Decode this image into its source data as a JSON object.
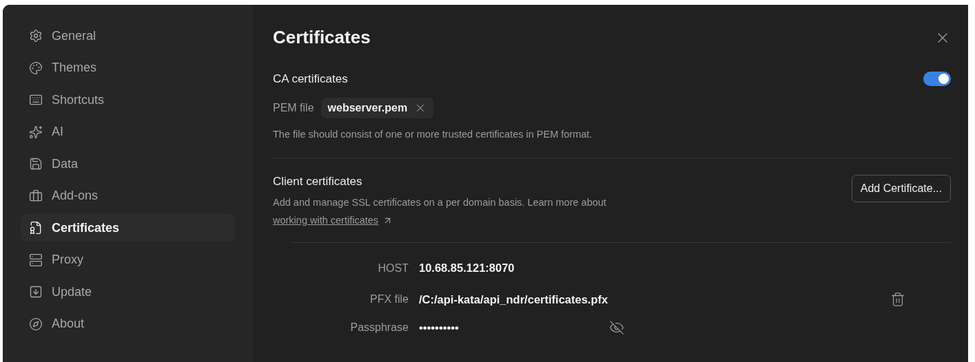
{
  "sidebar": {
    "items": [
      {
        "label": "General",
        "selected": false
      },
      {
        "label": "Themes",
        "selected": false
      },
      {
        "label": "Shortcuts",
        "selected": false
      },
      {
        "label": "AI",
        "selected": false
      },
      {
        "label": "Data",
        "selected": false
      },
      {
        "label": "Add-ons",
        "selected": false
      },
      {
        "label": "Certificates",
        "selected": true
      },
      {
        "label": "Proxy",
        "selected": false
      },
      {
        "label": "Update",
        "selected": false
      },
      {
        "label": "About",
        "selected": false
      }
    ]
  },
  "title": "Certificates",
  "ca": {
    "heading": "CA certificates",
    "on": true,
    "file_label": "PEM file",
    "file_name": "webserver.pem",
    "description": "The file should consist of one or more trusted certificates in PEM format."
  },
  "client": {
    "heading": "Client certificates",
    "description": "Add and manage SSL certificates on a per domain basis. Learn more about",
    "link": "working with certificates",
    "add_button": "Add Certificate...",
    "certificates": [
      {
        "host_label": "HOST",
        "host": "10.68.85.121:8070",
        "file_label": "PFX file",
        "file": "/C:/api-kata/api_ndr/certificates.pfx",
        "passphrase_label": "Passphrase",
        "passphrase": "••••••••••"
      }
    ]
  }
}
